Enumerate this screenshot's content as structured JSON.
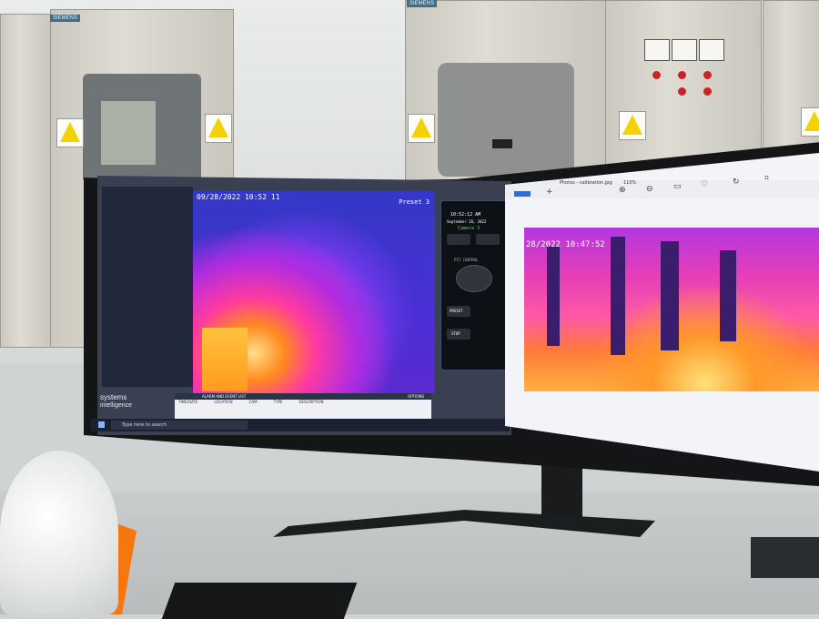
{
  "background_cabinets": {
    "brand_labels": [
      "SIEMENS",
      "SIEMENS"
    ]
  },
  "monitor": {
    "left_screen": {
      "camera_view": {
        "timestamp": "09/28/2022 10:52 11",
        "preset_label": "Preset 3"
      },
      "control_panel": {
        "time": "10:52:12 AM",
        "date": "September 28, 2022",
        "camera": "Camera 3",
        "section_label": "PTZ CONTROL",
        "buttons": [
          "PRESET",
          "STOP"
        ]
      },
      "logo": {
        "line1": "systems",
        "line2": "intelligence"
      },
      "alarm_panel": {
        "title": "ALARM AND EVENT LIST",
        "options_label": "OPTIONS",
        "columns": [
          "TIME/DATE",
          "LOCATION",
          "CAM",
          "TYPE",
          "DESCRIPTION"
        ]
      },
      "taskbar": {
        "search_placeholder": "Type here to search"
      }
    },
    "right_screen": {
      "titlebar": "Photos - calibration.jpg",
      "zoom": "110%",
      "thermal_timestamp": "28/2022 10:47:52"
    }
  },
  "colors": {
    "thermal_hot": "#ffe08a",
    "thermal_mid": "#ff3aa0",
    "thermal_cold": "#3438c6",
    "safety_vest": "#f6760f"
  }
}
